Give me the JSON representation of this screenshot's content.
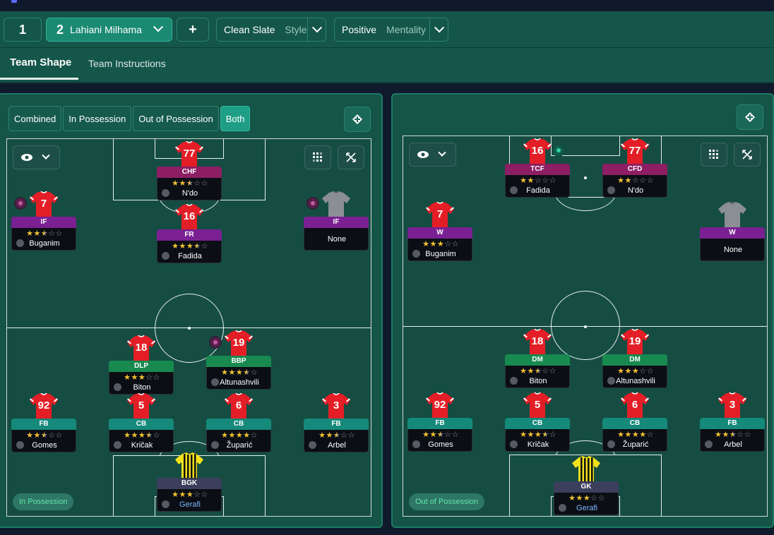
{
  "topbar": {
    "slot1": "1",
    "slot2_num": "2",
    "slot2_name": "Lahiani Milhama",
    "add_label": "+",
    "style": {
      "value": "Clean Slate",
      "label": "Style"
    },
    "mentality": {
      "value": "Positive",
      "label": "Mentality"
    }
  },
  "tabs": {
    "shape": "Team Shape",
    "instructions": "Team Instructions"
  },
  "phase_tabs": [
    "Combined",
    "In Possession",
    "Out of Possession",
    "Both"
  ],
  "left_pitch": {
    "label": "In Possession",
    "players": [
      {
        "num": "77",
        "role": "CHF",
        "stars": 2.5,
        "name": "N'do",
        "shirt": "red",
        "color": "magenta"
      },
      {
        "num": "16",
        "role": "FR",
        "stars": 3.5,
        "name": "Fadida",
        "shirt": "red",
        "color": "purple"
      },
      {
        "num": "7",
        "role": "IF",
        "stars": 2.5,
        "name": "Buganim",
        "shirt": "red",
        "color": "purple"
      },
      {
        "num": "",
        "role": "IF",
        "stars": 0,
        "name": "None",
        "shirt": "grey",
        "color": "purple"
      },
      {
        "num": "18",
        "role": "DLP",
        "stars": 3,
        "name": "Biton",
        "shirt": "red",
        "color": "green"
      },
      {
        "num": "19",
        "role": "BBP",
        "stars": 3.5,
        "name": "Altunashvili",
        "shirt": "red",
        "color": "green"
      },
      {
        "num": "92",
        "role": "FB",
        "stars": 2.5,
        "name": "Gomes",
        "shirt": "red",
        "color": "teal"
      },
      {
        "num": "5",
        "role": "CB",
        "stars": 3.5,
        "name": "Kričak",
        "shirt": "red",
        "color": "teal"
      },
      {
        "num": "6",
        "role": "CB",
        "stars": 4,
        "name": "Župarić",
        "shirt": "red",
        "color": "teal"
      },
      {
        "num": "3",
        "role": "FB",
        "stars": 2.5,
        "name": "Arbel",
        "shirt": "red",
        "color": "teal"
      },
      {
        "num": "",
        "role": "BGK",
        "stars": 3,
        "name": "Gerafi",
        "shirt": "yellow",
        "color": "slate"
      }
    ]
  },
  "right_pitch": {
    "label": "Out of Possession",
    "players": [
      {
        "num": "16",
        "role": "TCF",
        "stars": 2,
        "name": "Fadida",
        "shirt": "red",
        "color": "magenta"
      },
      {
        "num": "77",
        "role": "CFD",
        "stars": 2,
        "name": "N'do",
        "shirt": "red",
        "color": "magenta"
      },
      {
        "num": "7",
        "role": "W",
        "stars": 3,
        "name": "Buganim",
        "shirt": "red",
        "color": "purple"
      },
      {
        "num": "",
        "role": "W",
        "stars": 0,
        "name": "None",
        "shirt": "grey",
        "color": "purple"
      },
      {
        "num": "18",
        "role": "DM",
        "stars": 2.5,
        "name": "Biton",
        "shirt": "red",
        "color": "green"
      },
      {
        "num": "19",
        "role": "DM",
        "stars": 3,
        "name": "Altunashvili",
        "shirt": "red",
        "color": "green"
      },
      {
        "num": "92",
        "role": "FB",
        "stars": 2.5,
        "name": "Gomes",
        "shirt": "red",
        "color": "teal"
      },
      {
        "num": "5",
        "role": "CB",
        "stars": 3.5,
        "name": "Kričak",
        "shirt": "red",
        "color": "teal"
      },
      {
        "num": "6",
        "role": "CB",
        "stars": 4,
        "name": "Župarić",
        "shirt": "red",
        "color": "teal"
      },
      {
        "num": "3",
        "role": "FB",
        "stars": 2.5,
        "name": "Arbel",
        "shirt": "red",
        "color": "teal"
      },
      {
        "num": "",
        "role": "GK",
        "stars": 3,
        "name": "Gerafi",
        "shirt": "yellow",
        "color": "slate"
      }
    ]
  },
  "colors": {
    "toolbar_bg": "#14564a",
    "pitch_bg": "#154d43",
    "star": "#f1c232",
    "possession_pill": "#61e7a8"
  }
}
